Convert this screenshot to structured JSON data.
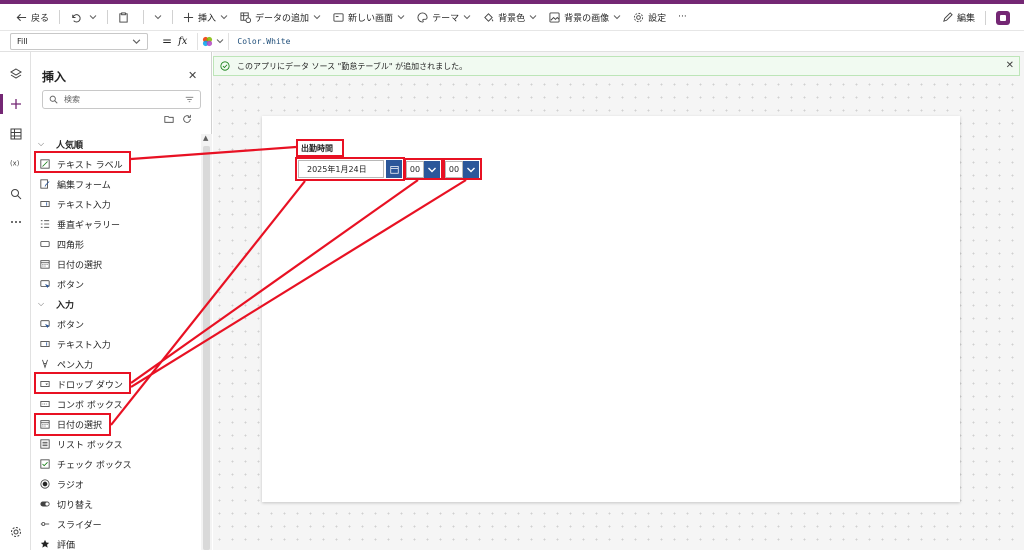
{
  "commandbar": {
    "back": "戻る",
    "insert": "挿入",
    "add_data": "データの追加",
    "new_screen": "新しい画面",
    "theme": "テーマ",
    "bg_color": "背景色",
    "bg_image": "背景の画像",
    "settings": "設定",
    "more": "···",
    "edit": "編集"
  },
  "formula_bar": {
    "property": "Fill",
    "equals": "=",
    "fx": "fx",
    "formula": "Color.White"
  },
  "notification": {
    "text": "このアプリにデータ ソース \"勤怠テーブル\" が追加されました。"
  },
  "insert_panel": {
    "title": "挿入",
    "search_placeholder": "検索",
    "categories": [
      {
        "name": "人気順"
      },
      {
        "name": "入力"
      }
    ],
    "popular_items": [
      "テキスト ラベル",
      "編集フォーム",
      "テキスト入力",
      "垂直ギャラリー",
      "四角形",
      "日付の選択",
      "ボタン"
    ],
    "input_items": [
      "ボタン",
      "テキスト入力",
      "ペン入力",
      "ドロップ ダウン",
      "コンボ ボックス",
      "日付の選択",
      "リスト ボックス",
      "チェック ボックス",
      "ラジオ",
      "切り替え",
      "スライダー",
      "評価"
    ]
  },
  "canvas": {
    "label": "出勤時間",
    "date_value": "2025年1月24日",
    "hour_value": "00",
    "minute_value": "00"
  },
  "colors": {
    "accent": "#742774",
    "highlight": "#e81123",
    "control_blue": "#2b579a"
  }
}
